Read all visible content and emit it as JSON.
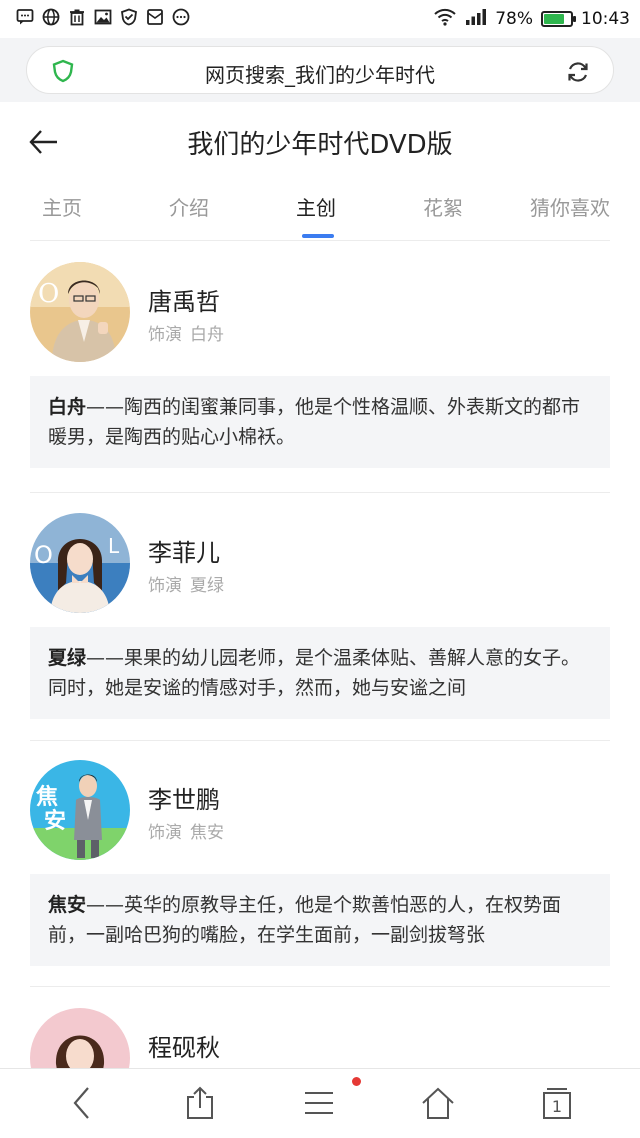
{
  "status_bar": {
    "icons_left": [
      "message-icon",
      "globe-icon",
      "trash-icon",
      "image-icon",
      "shield-icon",
      "mail-icon",
      "more-circle-icon"
    ],
    "battery_percent": "78%",
    "battery_level": 0.78,
    "time": "10:43",
    "battery_color": "#2fb64e"
  },
  "urlbar": {
    "text": "网页搜索_我们的少年时代",
    "shield_color": "#2fb64e"
  },
  "header": {
    "title": "我们的少年时代DVD版"
  },
  "tabs": [
    {
      "label": "主页",
      "active": false
    },
    {
      "label": "介绍",
      "active": false
    },
    {
      "label": "主创",
      "active": true
    },
    {
      "label": "花絮",
      "active": false
    },
    {
      "label": "猜你喜欢",
      "active": false
    }
  ],
  "accent_color": "#3b7cf0",
  "role_prefix": "饰演",
  "cast": [
    {
      "name": "唐禹哲",
      "role": "白舟",
      "character": "白舟",
      "desc": "——陶西的闺蜜兼同事，他是个性格温顺、外表斯文的都市暖男，是陶西的贴心小棉袄。"
    },
    {
      "name": "李菲儿",
      "role": "夏绿",
      "character": "夏绿",
      "desc": "——果果的幼儿园老师，是个温柔体贴、善解人意的女子。同时，她是安谧的情感对手，然而，她与安谧之间"
    },
    {
      "name": "李世鹏",
      "role": "焦安",
      "character": "焦安",
      "desc": "——英华的原教导主任，他是个欺善怕恶的人，在权势面前，一副哈巴狗的嘴脸，在学生面前，一副剑拔弩张"
    },
    {
      "name": "程砚秋",
      "role": "",
      "character": "",
      "desc": ""
    }
  ],
  "bottom_nav": {
    "tab_count": "1"
  }
}
